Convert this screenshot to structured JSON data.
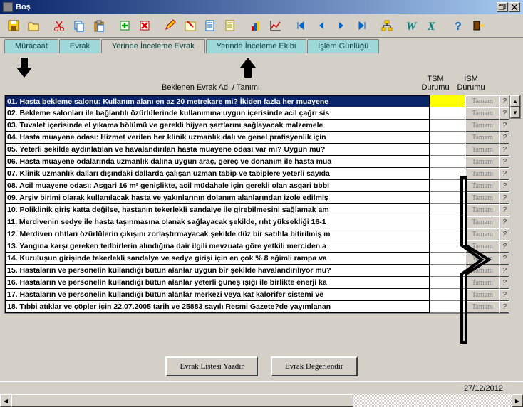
{
  "window": {
    "title": "Boş"
  },
  "tabs": [
    "Müracaat",
    "Evrak",
    "Yerinde İnceleme Evrak",
    "Yerinde İnceleme Ekibi",
    "İşlem Günlüğü"
  ],
  "active_tab": 2,
  "headers": {
    "name": "Beklenen Evrak Adı / Tanımı",
    "tsm": "TSM Durumu",
    "ism": "İSM Durumu"
  },
  "rows": [
    {
      "text": "01. Hasta bekleme salonu: Kullanım alanı en az 20 metrekare mi? İkiden fazla her muayene",
      "ism": "Tamam",
      "selected": true
    },
    {
      "text": "02. Bekleme salonları ile bağlantılı özürlülerinde kullanımına uygun içerisinde acil çağrı sis",
      "ism": "Tamam"
    },
    {
      "text": "03. Tuvalet içerisinde el yıkama bölümü ve gerekli hijyen şartlarını sağlayacak malzemele",
      "ism": "Tamam"
    },
    {
      "text": "04. Hasta muayene odası: Hizmet verilen her klinik uzmanlık dalı ve genel pratisyenlik için",
      "ism": "Tamam"
    },
    {
      "text": "05. Yeterli şekilde aydınlatılan ve havalandırılan hasta muayene odası var mı? Uygun mu?",
      "ism": "Tamam"
    },
    {
      "text": "06. Hasta muayene odalarında uzmanlık dalına uygun araç, gereç ve donanım ile hasta mua",
      "ism": "Tamam"
    },
    {
      "text": "07. Klinik uzmanlık dalları dışındaki dallarda çalışan uzman tabip ve tabiplere yeterli sayıda",
      "ism": "Tamam"
    },
    {
      "text": "08. Acil muayene odası: Asgari 16 m² genişlikte, acil müdahale için gerekli olan asgari tıbbi",
      "ism": "Tamam"
    },
    {
      "text": "09. Arşiv birimi olarak kullanılacak hasta ve yakınlarının dolanım alanlarından izole edilmiş",
      "ism": "Tamam"
    },
    {
      "text": "10. Poliklinik giriş katta değilse, hastanın tekerlekli sandalye ile girebilmesini sağlamak am",
      "ism": "Tamam"
    },
    {
      "text": "11. Merdivenin sedye ile hasta taşınmasına olanak sağlayacak şekilde, rıht yüksekliği 16-1",
      "ism": "Tamam"
    },
    {
      "text": "12. Merdiven rıhtları özürlülerin çıkışını zorlaştırmayacak şekilde düz bir satıhla bitirilmiş m",
      "ism": "Tamam"
    },
    {
      "text": "13. Yangına karşı gereken tedbirlerin alındığına dair ilgili mevzuata göre yetkili merciden a",
      "ism": "Tamam"
    },
    {
      "text": "14. Kuruluşun girişinde tekerlekli sandalye ve sedye girişi için en çok % 8 eğimli rampa va",
      "ism": "Tamam"
    },
    {
      "text": "15. Hastaların ve personelin kullandığı bütün alanlar uygun bir şekilde havalandırılıyor mu?",
      "ism": "Tamam"
    },
    {
      "text": "16. Hastaların ve personelin kullandığı bütün alanlar yeterli güneş ışığı ile birlikte enerji ka",
      "ism": "Tamam"
    },
    {
      "text": "17. Hastaların ve personelin kullandığı bütün alanlar merkezi veya kat kalorifer sistemi ve",
      "ism": "Tamam"
    },
    {
      "text": "18. Tıbbi atıklar ve çöpler için 22.07.2005 tarih ve 25883 sayılı Resmi Gazete?de yayımlanan",
      "ism": "Tamam"
    }
  ],
  "buttons": {
    "print": "Evrak Listesi Yazdır",
    "evaluate": "Evrak Değerlendir"
  },
  "status_date": "27/12/2012",
  "icons": {
    "save": "save",
    "open": "open",
    "cut": "cut",
    "copy": "copy",
    "paste": "paste",
    "new": "new",
    "delete": "delete",
    "edit": "edit",
    "edit2": "edit2",
    "props": "props",
    "list": "list",
    "chart1": "chart1",
    "chart2": "chart2",
    "first": "first",
    "prev": "prev",
    "next": "next",
    "last": "last",
    "tree": "tree",
    "W": "W",
    "X": "X",
    "help": "help",
    "exit": "exit"
  }
}
